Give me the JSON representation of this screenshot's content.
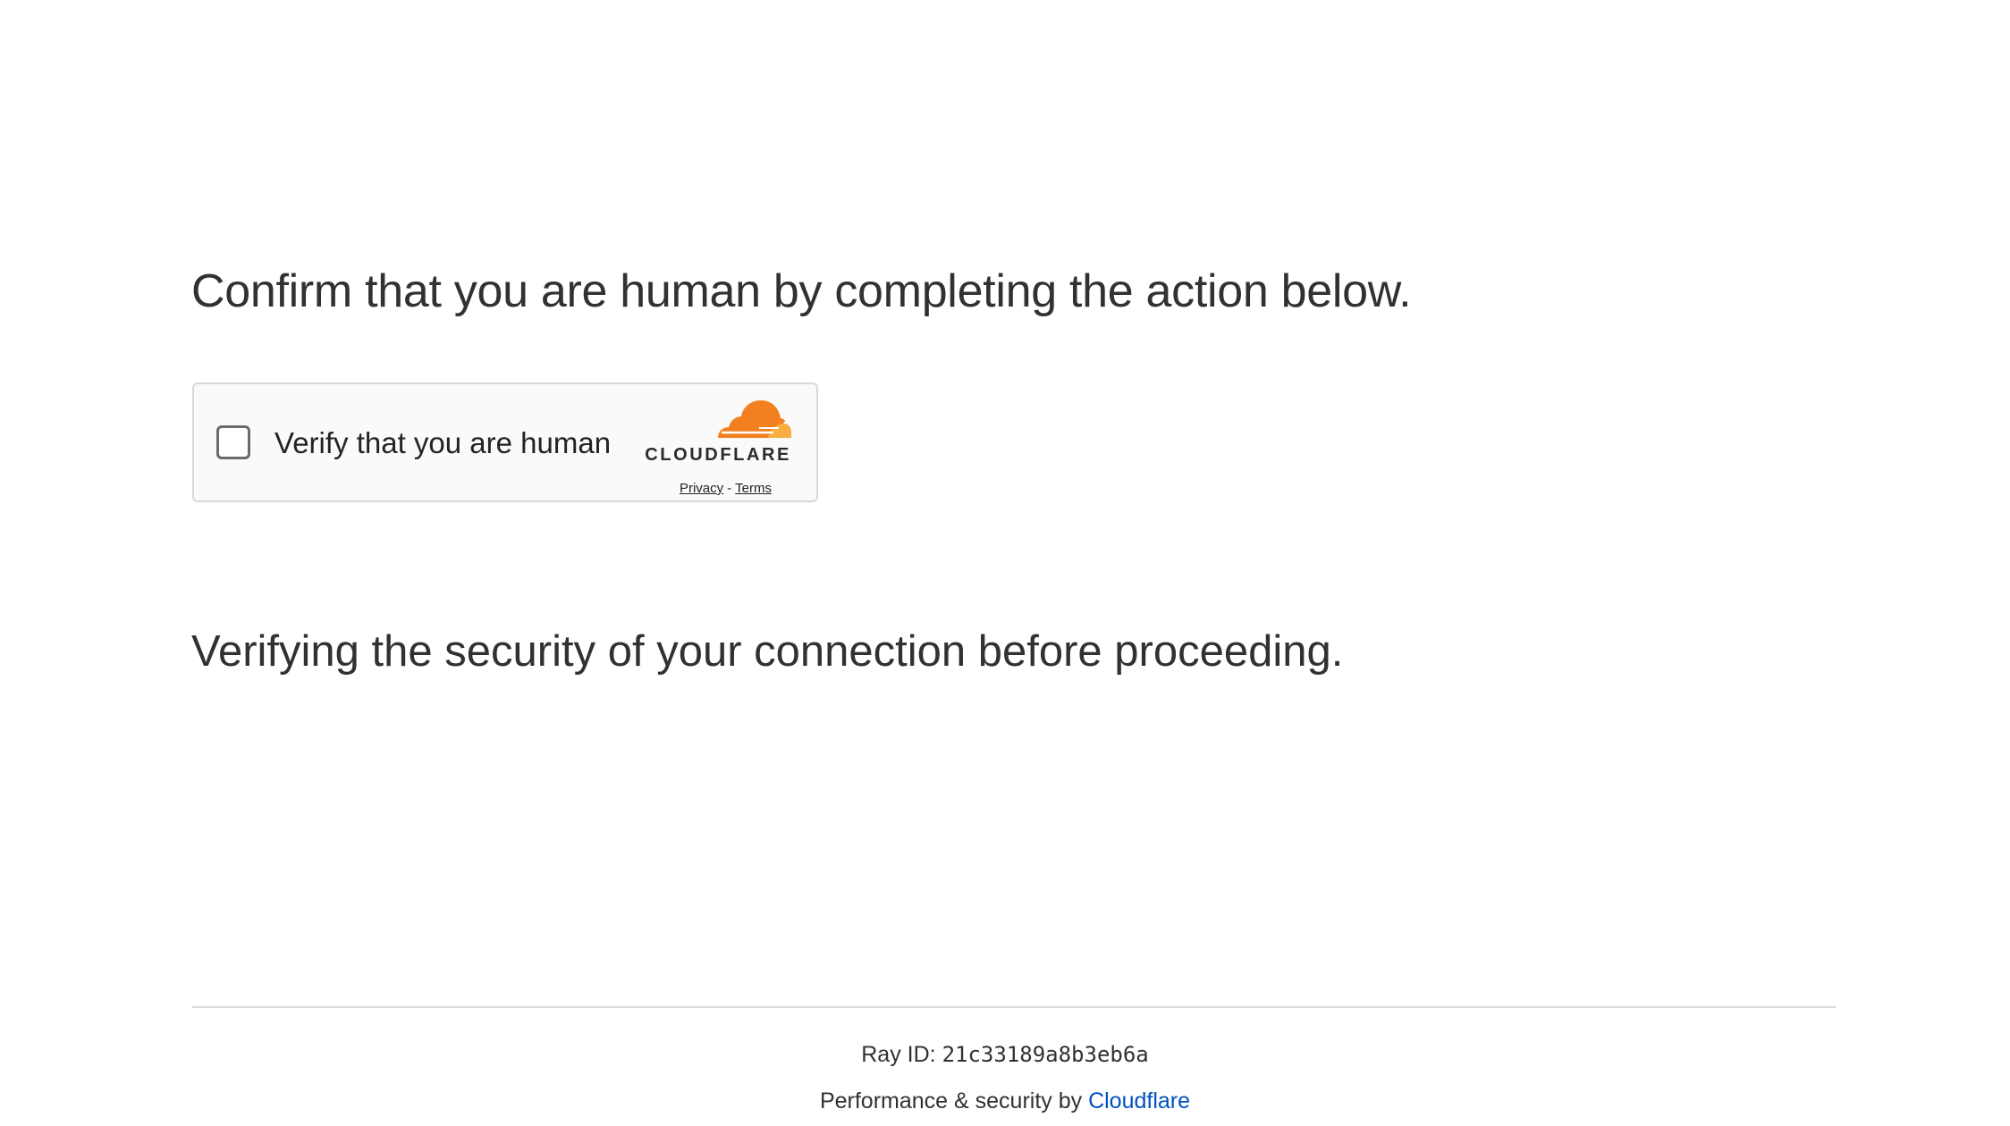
{
  "main": {
    "heading": "Confirm that you are human by completing the action below.",
    "subheading": "Verifying the security of your connection before proceeding."
  },
  "challenge_widget": {
    "checkbox_checked": false,
    "label": "Verify that you are human",
    "brand_wordmark": "CLOUDFLARE",
    "privacy_link": "Privacy",
    "separator": "-",
    "terms_link": "Terms"
  },
  "footer": {
    "ray_id_label": "Ray ID:",
    "ray_id_value": "21c33189a8b3eb6a",
    "perf_text": "Performance & security by",
    "perf_link": "Cloudflare"
  },
  "colors": {
    "text": "#313131",
    "link": "#0051c3",
    "cloud_orange": "#f38020",
    "cloud_light_orange": "#faae40",
    "border": "#d9d9d9"
  }
}
